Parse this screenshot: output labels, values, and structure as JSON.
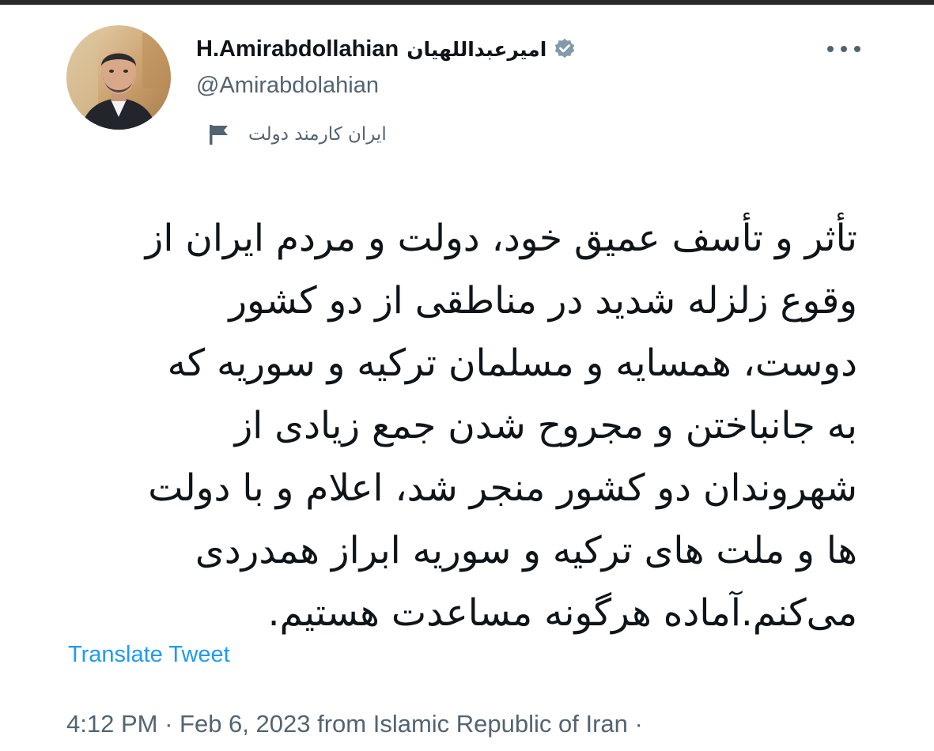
{
  "user": {
    "display_name": "H.Amirabdollahian",
    "display_name_fa": "امیرعبداللهیان",
    "handle": "@Amirabdolahian",
    "verified_icon": "verified-badge-icon",
    "label_icon": "flag-icon",
    "label_text": "ایران کارمند دولت",
    "avatar": "profile-photo"
  },
  "menu": {
    "more_icon": "ellipsis-icon"
  },
  "tweet": {
    "lines": [
      "تأثر و تأسف عمیق خود، دولت و مردم ایران از",
      "وقوع زلزله شدید در مناطقی از دو کشور",
      "دوست، همسایه و مسلمان ترکیه و سوریه که",
      "به جانباختن و مجروح شدن جمع زیادی از",
      "شهروندان دو کشور منجر شد، اعلام و با دولت",
      "ها و ملت های ترکیه و سوریه ابراز همدردی",
      "می‌کنم.آماده هرگونه مساعدت هستیم."
    ],
    "translate_label": "Translate Tweet",
    "time": "4:12 PM",
    "separator": " · ",
    "date": "Feb 6, 2023",
    "source": " from Islamic Republic of Iran",
    "trailing": " ·"
  },
  "colors": {
    "text": "#0f1419",
    "secondary": "#536471",
    "link": "#1d9bf0",
    "verified": "#829aab"
  }
}
